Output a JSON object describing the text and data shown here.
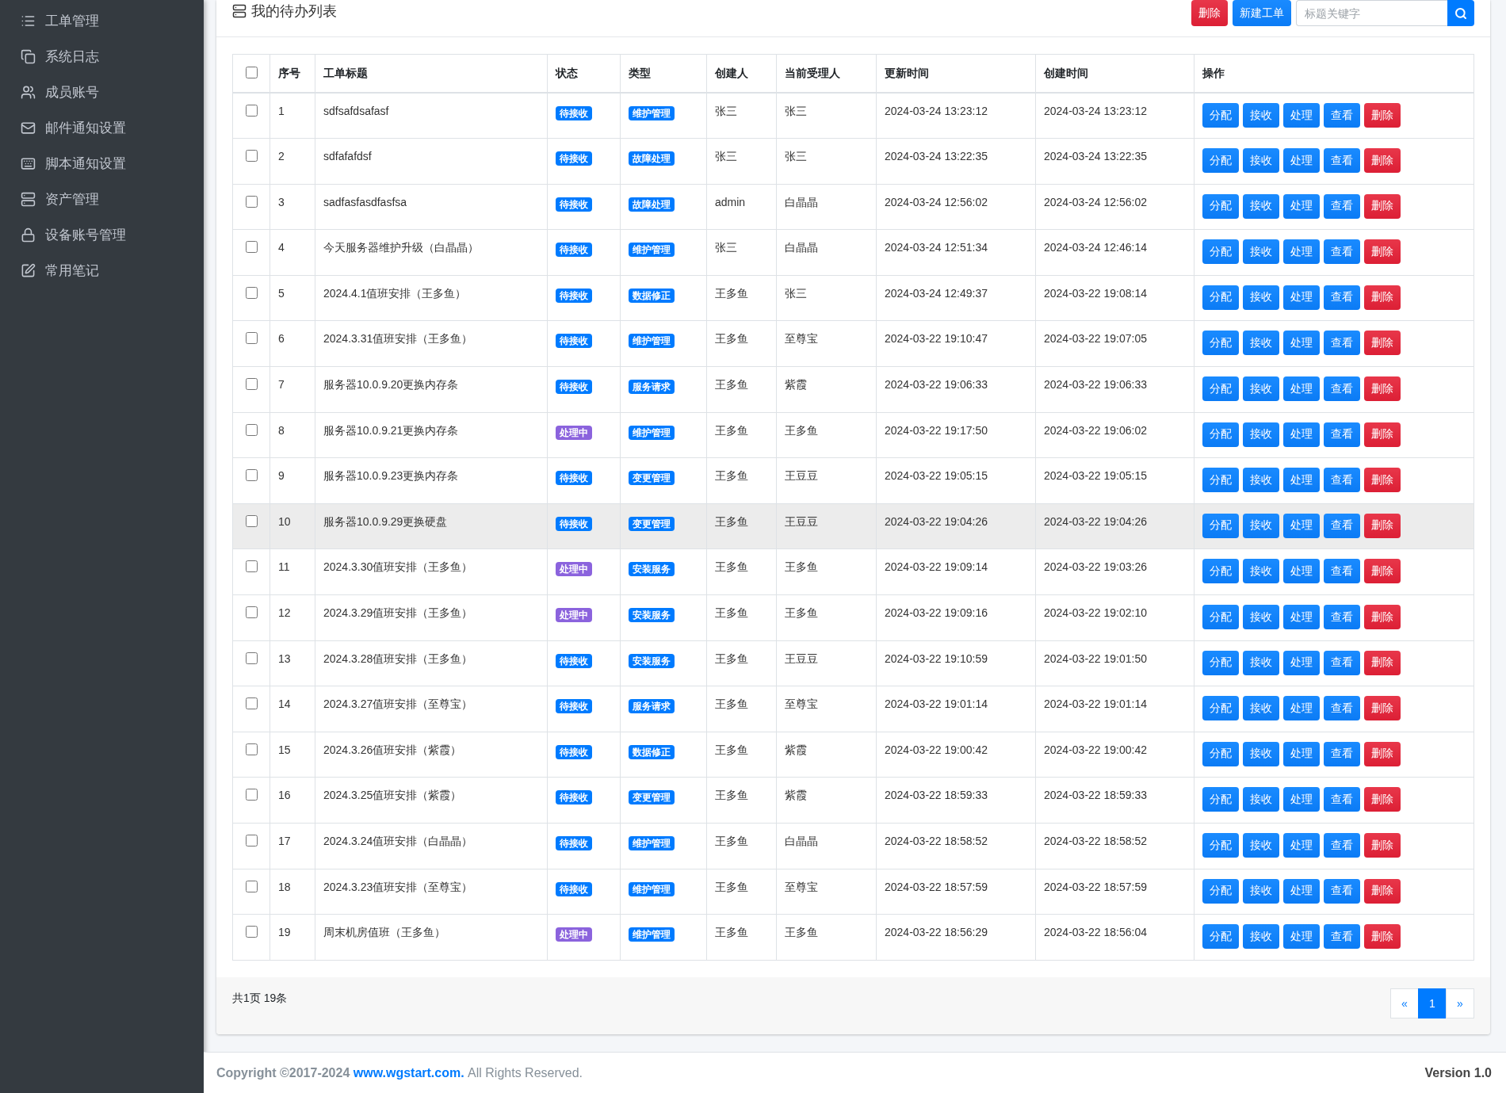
{
  "sidebar": {
    "items": [
      {
        "label": "工单管理"
      },
      {
        "label": "系统日志"
      },
      {
        "label": "成员账号"
      },
      {
        "label": "邮件通知设置"
      },
      {
        "label": "脚本通知设置"
      },
      {
        "label": "资产管理"
      },
      {
        "label": "设备账号管理"
      },
      {
        "label": "常用笔记"
      }
    ]
  },
  "card": {
    "title": "我的待办列表",
    "delete_button": "删除",
    "new_button": "新建工单",
    "search": {
      "placeholder": "标题关键字"
    }
  },
  "table": {
    "select_all": {
      "checked": false
    },
    "columns": [
      "序号",
      "工单标题",
      "状态",
      "类型",
      "创建人",
      "当前受理人",
      "更新时间",
      "创建时间",
      "操作"
    ],
    "rows": [
      {
        "checked": false,
        "highlighted": false,
        "no": "1",
        "title": "sdfsafdsafasf",
        "status": {
          "label": "待接收",
          "color": "#007bff"
        },
        "type": "维护管理",
        "creator": "张三",
        "assignee": "张三",
        "updated": "2024-03-24 13:23:12",
        "created": "2024-03-24 13:23:12",
        "actions": [
          {
            "label": "分配",
            "kind": "primary"
          },
          {
            "label": "接收",
            "kind": "primary"
          },
          {
            "label": "处理",
            "kind": "primary"
          },
          {
            "label": "查看",
            "kind": "primary"
          },
          {
            "label": "删除",
            "kind": "danger"
          }
        ]
      },
      {
        "checked": false,
        "highlighted": false,
        "no": "2",
        "title": "sdfafafdsf",
        "status": {
          "label": "待接收",
          "color": "#007bff"
        },
        "type": "故障处理",
        "creator": "张三",
        "assignee": "张三",
        "updated": "2024-03-24 13:22:35",
        "created": "2024-03-24 13:22:35",
        "actions": [
          {
            "label": "分配",
            "kind": "primary"
          },
          {
            "label": "接收",
            "kind": "primary"
          },
          {
            "label": "处理",
            "kind": "primary"
          },
          {
            "label": "查看",
            "kind": "primary"
          },
          {
            "label": "删除",
            "kind": "danger"
          }
        ]
      },
      {
        "checked": false,
        "highlighted": false,
        "no": "3",
        "title": "sadfasfasdfasfsa",
        "status": {
          "label": "待接收",
          "color": "#007bff"
        },
        "type": "故障处理",
        "creator": "admin",
        "assignee": "白晶晶",
        "updated": "2024-03-24 12:56:02",
        "created": "2024-03-24 12:56:02",
        "actions": [
          {
            "label": "分配",
            "kind": "primary"
          },
          {
            "label": "接收",
            "kind": "primary"
          },
          {
            "label": "处理",
            "kind": "primary"
          },
          {
            "label": "查看",
            "kind": "primary"
          },
          {
            "label": "删除",
            "kind": "danger"
          }
        ]
      },
      {
        "checked": false,
        "highlighted": false,
        "no": "4",
        "title": "今天服务器维护升级（白晶晶）",
        "status": {
          "label": "待接收",
          "color": "#007bff"
        },
        "type": "维护管理",
        "creator": "张三",
        "assignee": "白晶晶",
        "updated": "2024-03-24 12:51:34",
        "created": "2024-03-24 12:46:14",
        "actions": [
          {
            "label": "分配",
            "kind": "primary"
          },
          {
            "label": "接收",
            "kind": "primary"
          },
          {
            "label": "处理",
            "kind": "primary"
          },
          {
            "label": "查看",
            "kind": "primary"
          },
          {
            "label": "删除",
            "kind": "danger"
          }
        ]
      },
      {
        "checked": false,
        "highlighted": false,
        "no": "5",
        "title": "2024.4.1值班安排（王多鱼）",
        "status": {
          "label": "待接收",
          "color": "#007bff"
        },
        "type": "数据修正",
        "creator": "王多鱼",
        "assignee": "张三",
        "updated": "2024-03-24 12:49:37",
        "created": "2024-03-22 19:08:14",
        "actions": [
          {
            "label": "分配",
            "kind": "primary"
          },
          {
            "label": "接收",
            "kind": "primary"
          },
          {
            "label": "处理",
            "kind": "primary"
          },
          {
            "label": "查看",
            "kind": "primary"
          },
          {
            "label": "删除",
            "kind": "danger"
          }
        ]
      },
      {
        "checked": false,
        "highlighted": false,
        "no": "6",
        "title": "2024.3.31值班安排（王多鱼）",
        "status": {
          "label": "待接收",
          "color": "#007bff"
        },
        "type": "维护管理",
        "creator": "王多鱼",
        "assignee": "至尊宝",
        "updated": "2024-03-22 19:10:47",
        "created": "2024-03-22 19:07:05",
        "actions": [
          {
            "label": "分配",
            "kind": "primary"
          },
          {
            "label": "接收",
            "kind": "primary"
          },
          {
            "label": "处理",
            "kind": "primary"
          },
          {
            "label": "查看",
            "kind": "primary"
          },
          {
            "label": "删除",
            "kind": "danger"
          }
        ]
      },
      {
        "checked": false,
        "highlighted": false,
        "no": "7",
        "title": "服务器10.0.9.20更换内存条",
        "status": {
          "label": "待接收",
          "color": "#007bff"
        },
        "type": "服务请求",
        "creator": "王多鱼",
        "assignee": "紫霞",
        "updated": "2024-03-22 19:06:33",
        "created": "2024-03-22 19:06:33",
        "actions": [
          {
            "label": "分配",
            "kind": "primary"
          },
          {
            "label": "接收",
            "kind": "primary"
          },
          {
            "label": "处理",
            "kind": "primary"
          },
          {
            "label": "查看",
            "kind": "primary"
          },
          {
            "label": "删除",
            "kind": "danger"
          }
        ]
      },
      {
        "checked": false,
        "highlighted": false,
        "no": "8",
        "title": "服务器10.0.9.21更换内存条",
        "status": {
          "label": "处理中",
          "color": "#8b63dd"
        },
        "type": "维护管理",
        "creator": "王多鱼",
        "assignee": "王多鱼",
        "updated": "2024-03-22 19:17:50",
        "created": "2024-03-22 19:06:02",
        "actions": [
          {
            "label": "分配",
            "kind": "primary"
          },
          {
            "label": "接收",
            "kind": "primary"
          },
          {
            "label": "处理",
            "kind": "primary"
          },
          {
            "label": "查看",
            "kind": "primary"
          },
          {
            "label": "删除",
            "kind": "danger"
          }
        ]
      },
      {
        "checked": false,
        "highlighted": false,
        "no": "9",
        "title": "服务器10.0.9.23更换内存条",
        "status": {
          "label": "待接收",
          "color": "#007bff"
        },
        "type": "变更管理",
        "creator": "王多鱼",
        "assignee": "王豆豆",
        "updated": "2024-03-22 19:05:15",
        "created": "2024-03-22 19:05:15",
        "actions": [
          {
            "label": "分配",
            "kind": "primary"
          },
          {
            "label": "接收",
            "kind": "primary"
          },
          {
            "label": "处理",
            "kind": "primary"
          },
          {
            "label": "查看",
            "kind": "primary"
          },
          {
            "label": "删除",
            "kind": "danger"
          }
        ]
      },
      {
        "checked": false,
        "highlighted": true,
        "no": "10",
        "title": "服务器10.0.9.29更换硬盘",
        "status": {
          "label": "待接收",
          "color": "#007bff"
        },
        "type": "变更管理",
        "creator": "王多鱼",
        "assignee": "王豆豆",
        "updated": "2024-03-22 19:04:26",
        "created": "2024-03-22 19:04:26",
        "actions": [
          {
            "label": "分配",
            "kind": "primary"
          },
          {
            "label": "接收",
            "kind": "primary"
          },
          {
            "label": "处理",
            "kind": "primary"
          },
          {
            "label": "查看",
            "kind": "primary"
          },
          {
            "label": "删除",
            "kind": "danger"
          }
        ]
      },
      {
        "checked": false,
        "highlighted": false,
        "no": "11",
        "title": "2024.3.30值班安排（王多鱼）",
        "status": {
          "label": "处理中",
          "color": "#8b63dd"
        },
        "type": "安装服务",
        "creator": "王多鱼",
        "assignee": "王多鱼",
        "updated": "2024-03-22 19:09:14",
        "created": "2024-03-22 19:03:26",
        "actions": [
          {
            "label": "分配",
            "kind": "primary"
          },
          {
            "label": "接收",
            "kind": "primary"
          },
          {
            "label": "处理",
            "kind": "primary"
          },
          {
            "label": "查看",
            "kind": "primary"
          },
          {
            "label": "删除",
            "kind": "danger"
          }
        ]
      },
      {
        "checked": false,
        "highlighted": false,
        "no": "12",
        "title": "2024.3.29值班安排（王多鱼）",
        "status": {
          "label": "处理中",
          "color": "#8b63dd"
        },
        "type": "安装服务",
        "creator": "王多鱼",
        "assignee": "王多鱼",
        "updated": "2024-03-22 19:09:16",
        "created": "2024-03-22 19:02:10",
        "actions": [
          {
            "label": "分配",
            "kind": "primary"
          },
          {
            "label": "接收",
            "kind": "primary"
          },
          {
            "label": "处理",
            "kind": "primary"
          },
          {
            "label": "查看",
            "kind": "primary"
          },
          {
            "label": "删除",
            "kind": "danger"
          }
        ]
      },
      {
        "checked": false,
        "highlighted": false,
        "no": "13",
        "title": "2024.3.28值班安排（王多鱼）",
        "status": {
          "label": "待接收",
          "color": "#007bff"
        },
        "type": "安装服务",
        "creator": "王多鱼",
        "assignee": "王豆豆",
        "updated": "2024-03-22 19:10:59",
        "created": "2024-03-22 19:01:50",
        "actions": [
          {
            "label": "分配",
            "kind": "primary"
          },
          {
            "label": "接收",
            "kind": "primary"
          },
          {
            "label": "处理",
            "kind": "primary"
          },
          {
            "label": "查看",
            "kind": "primary"
          },
          {
            "label": "删除",
            "kind": "danger"
          }
        ]
      },
      {
        "checked": false,
        "highlighted": false,
        "no": "14",
        "title": "2024.3.27值班安排（至尊宝）",
        "status": {
          "label": "待接收",
          "color": "#007bff"
        },
        "type": "服务请求",
        "creator": "王多鱼",
        "assignee": "至尊宝",
        "updated": "2024-03-22 19:01:14",
        "created": "2024-03-22 19:01:14",
        "actions": [
          {
            "label": "分配",
            "kind": "primary"
          },
          {
            "label": "接收",
            "kind": "primary"
          },
          {
            "label": "处理",
            "kind": "primary"
          },
          {
            "label": "查看",
            "kind": "primary"
          },
          {
            "label": "删除",
            "kind": "danger"
          }
        ]
      },
      {
        "checked": false,
        "highlighted": false,
        "no": "15",
        "title": "2024.3.26值班安排（紫霞）",
        "status": {
          "label": "待接收",
          "color": "#007bff"
        },
        "type": "数据修正",
        "creator": "王多鱼",
        "assignee": "紫霞",
        "updated": "2024-03-22 19:00:42",
        "created": "2024-03-22 19:00:42",
        "actions": [
          {
            "label": "分配",
            "kind": "primary"
          },
          {
            "label": "接收",
            "kind": "primary"
          },
          {
            "label": "处理",
            "kind": "primary"
          },
          {
            "label": "查看",
            "kind": "primary"
          },
          {
            "label": "删除",
            "kind": "danger"
          }
        ]
      },
      {
        "checked": false,
        "highlighted": false,
        "no": "16",
        "title": "2024.3.25值班安排（紫霞）",
        "status": {
          "label": "待接收",
          "color": "#007bff"
        },
        "type": "变更管理",
        "creator": "王多鱼",
        "assignee": "紫霞",
        "updated": "2024-03-22 18:59:33",
        "created": "2024-03-22 18:59:33",
        "actions": [
          {
            "label": "分配",
            "kind": "primary"
          },
          {
            "label": "接收",
            "kind": "primary"
          },
          {
            "label": "处理",
            "kind": "primary"
          },
          {
            "label": "查看",
            "kind": "primary"
          },
          {
            "label": "删除",
            "kind": "danger"
          }
        ]
      },
      {
        "checked": false,
        "highlighted": false,
        "no": "17",
        "title": "2024.3.24值班安排（白晶晶）",
        "status": {
          "label": "待接收",
          "color": "#007bff"
        },
        "type": "维护管理",
        "creator": "王多鱼",
        "assignee": "白晶晶",
        "updated": "2024-03-22 18:58:52",
        "created": "2024-03-22 18:58:52",
        "actions": [
          {
            "label": "分配",
            "kind": "primary"
          },
          {
            "label": "接收",
            "kind": "primary"
          },
          {
            "label": "处理",
            "kind": "primary"
          },
          {
            "label": "查看",
            "kind": "primary"
          },
          {
            "label": "删除",
            "kind": "danger"
          }
        ]
      },
      {
        "checked": false,
        "highlighted": false,
        "no": "18",
        "title": "2024.3.23值班安排（至尊宝）",
        "status": {
          "label": "待接收",
          "color": "#007bff"
        },
        "type": "维护管理",
        "creator": "王多鱼",
        "assignee": "至尊宝",
        "updated": "2024-03-22 18:57:59",
        "created": "2024-03-22 18:57:59",
        "actions": [
          {
            "label": "分配",
            "kind": "primary"
          },
          {
            "label": "接收",
            "kind": "primary"
          },
          {
            "label": "处理",
            "kind": "primary"
          },
          {
            "label": "查看",
            "kind": "primary"
          },
          {
            "label": "删除",
            "kind": "danger"
          }
        ]
      },
      {
        "checked": false,
        "highlighted": false,
        "no": "19",
        "title": "周末机房值班（王多鱼）",
        "status": {
          "label": "处理中",
          "color": "#8b63dd"
        },
        "type": "维护管理",
        "creator": "王多鱼",
        "assignee": "王多鱼",
        "updated": "2024-03-22 18:56:29",
        "created": "2024-03-22 18:56:04",
        "actions": [
          {
            "label": "分配",
            "kind": "primary"
          },
          {
            "label": "接收",
            "kind": "primary"
          },
          {
            "label": "处理",
            "kind": "primary"
          },
          {
            "label": "查看",
            "kind": "primary"
          },
          {
            "label": "删除",
            "kind": "danger"
          }
        ]
      }
    ]
  },
  "pagination": {
    "summary": "共1页 19条",
    "pages": [
      {
        "label": "«",
        "selected": false
      },
      {
        "label": "1",
        "selected": true
      },
      {
        "label": "»",
        "selected": false
      }
    ]
  },
  "footer": {
    "copyright": "Copyright ©2017-2024",
    "link": "www.wgstart.com.",
    "rights": "All Rights Reserved.",
    "version": "Version 1.0"
  }
}
